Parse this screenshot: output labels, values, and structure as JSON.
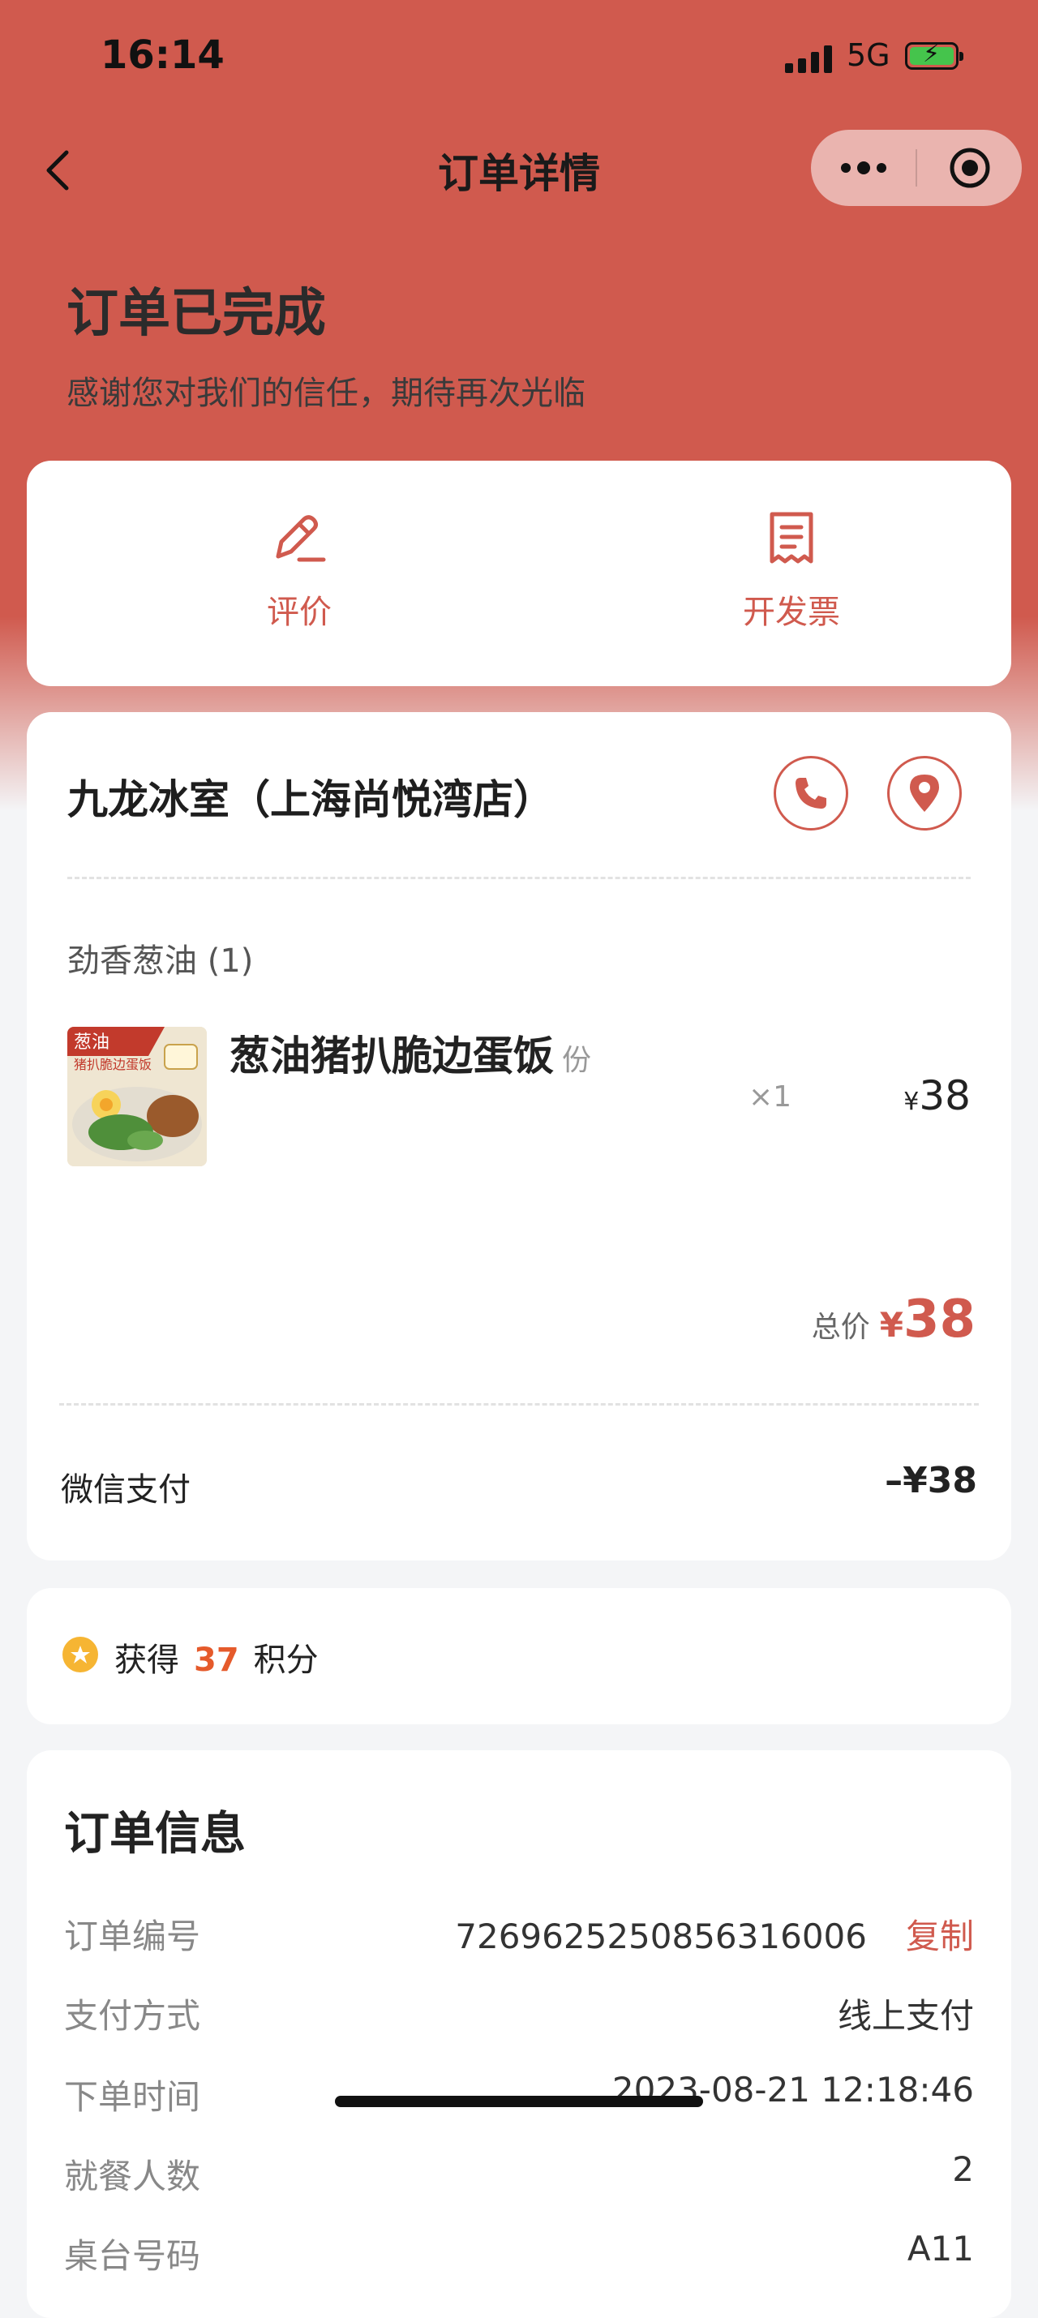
{
  "status_bar": {
    "time": "16:14",
    "network": "5G"
  },
  "nav": {
    "title": "订单详情"
  },
  "order_status": {
    "title": "订单已完成",
    "subtitle": "感谢您对我们的信任，期待再次光临"
  },
  "actions": {
    "review_label": "评价",
    "invoice_label": "开发票"
  },
  "store": {
    "name": "九龙冰室（上海尚悦湾店）"
  },
  "order": {
    "category": "劲香葱油 (1)",
    "item": {
      "name": "葱油猪扒脆边蛋饭",
      "unit": "份",
      "image_title": "葱油",
      "image_subtitle": "猪扒脆边蛋饭",
      "quantity": "×1",
      "price_symbol": "¥",
      "price": "38"
    },
    "total_label": "总价",
    "total_symbol": "¥",
    "total_value": "38",
    "payment_label": "微信支付",
    "payment_value": "–¥38"
  },
  "points": {
    "prefix": "获得",
    "value": "37",
    "suffix": "积分"
  },
  "info": {
    "title": "订单信息",
    "order_no_label": "订单编号",
    "order_no": "7269625250856316006",
    "copy_label": "复制",
    "pay_method_label": "支付方式",
    "pay_method": "线上支付",
    "order_time_label": "下单时间",
    "order_time": "2023-08-21 12:18:46",
    "diners_label": "就餐人数",
    "diners": "2",
    "table_label": "桌台号码",
    "table": "A11"
  },
  "colors": {
    "accent": "#d05a4e",
    "background": "#f4f5f7",
    "points": "#e55a2b"
  }
}
